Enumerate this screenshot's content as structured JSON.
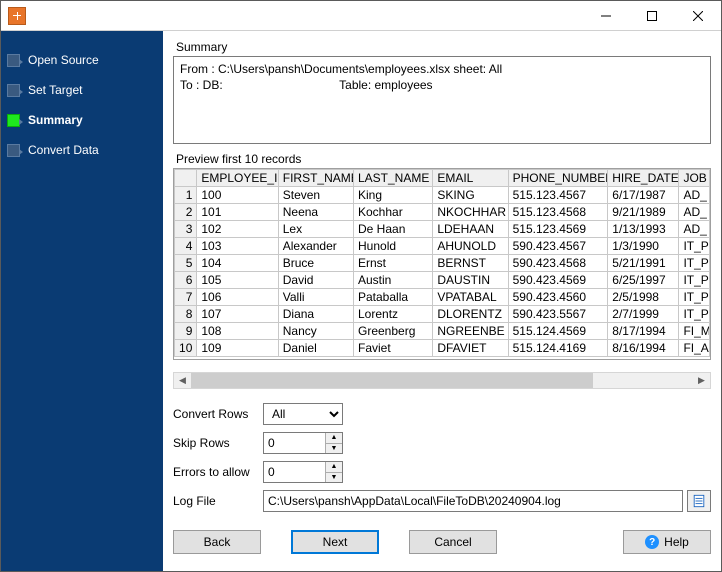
{
  "sidebar": {
    "steps": [
      {
        "label": "Open Source"
      },
      {
        "label": "Set Target"
      },
      {
        "label": "Summary"
      },
      {
        "label": "Convert Data"
      }
    ],
    "active_index": 2
  },
  "summary": {
    "title": "Summary",
    "text": "From : C:\\Users\\pansh\\Documents\\employees.xlsx sheet: All\nTo : DB:                                   Table: employees"
  },
  "preview": {
    "title": "Preview first 10 records",
    "columns": [
      "EMPLOYEE_ID",
      "FIRST_NAME",
      "LAST_NAME",
      "EMAIL",
      "PHONE_NUMBER",
      "HIRE_DATE",
      "JOB"
    ],
    "rows": [
      [
        "100",
        "Steven",
        "King",
        "SKING",
        "515.123.4567",
        "6/17/1987",
        "AD_"
      ],
      [
        "101",
        "Neena",
        "Kochhar",
        "NKOCHHAR",
        "515.123.4568",
        "9/21/1989",
        "AD_"
      ],
      [
        "102",
        "Lex",
        "De Haan",
        "LDEHAAN",
        "515.123.4569",
        "1/13/1993",
        "AD_"
      ],
      [
        "103",
        "Alexander",
        "Hunold",
        "AHUNOLD",
        "590.423.4567",
        "1/3/1990",
        "IT_P"
      ],
      [
        "104",
        "Bruce",
        "Ernst",
        "BERNST",
        "590.423.4568",
        "5/21/1991",
        "IT_P"
      ],
      [
        "105",
        "David",
        "Austin",
        "DAUSTIN",
        "590.423.4569",
        "6/25/1997",
        "IT_P"
      ],
      [
        "106",
        "Valli",
        "Pataballa",
        "VPATABAL",
        "590.423.4560",
        "2/5/1998",
        "IT_P"
      ],
      [
        "107",
        "Diana",
        "Lorentz",
        "DLORENTZ",
        "590.423.5567",
        "2/7/1999",
        "IT_P"
      ],
      [
        "108",
        "Nancy",
        "Greenberg",
        "NGREENBE",
        "515.124.4569",
        "8/17/1994",
        "FI_M"
      ],
      [
        "109",
        "Daniel",
        "Faviet",
        "DFAVIET",
        "515.124.4169",
        "8/16/1994",
        "FI_A"
      ]
    ]
  },
  "options": {
    "convert_rows_label": "Convert Rows",
    "convert_rows_value": "All",
    "skip_rows_label": "Skip Rows",
    "skip_rows_value": "0",
    "errors_label": "Errors to allow",
    "errors_value": "0",
    "logfile_label": "Log File",
    "logfile_value": "C:\\Users\\pansh\\AppData\\Local\\FileToDB\\20240904.log"
  },
  "buttons": {
    "back": "Back",
    "next": "Next",
    "cancel": "Cancel",
    "help": "Help"
  },
  "col_widths": [
    "80px",
    "74px",
    "78px",
    "74px",
    "98px",
    "70px",
    "30px"
  ]
}
